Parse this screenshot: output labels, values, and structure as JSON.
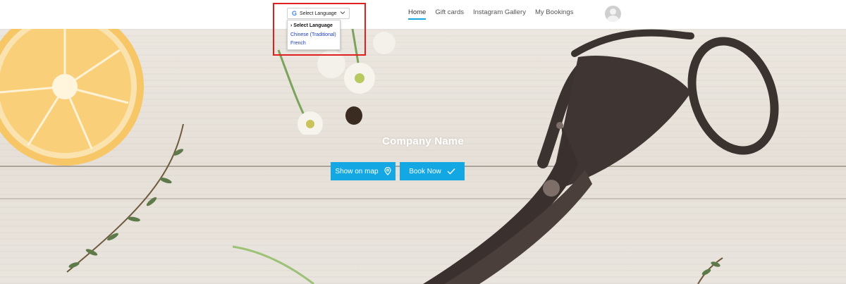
{
  "header": {
    "language_widget": {
      "selected": "Select Language",
      "google_icon": "G",
      "options": [
        "› Select Language",
        "Chinese (Traditional)",
        "French"
      ]
    },
    "nav": {
      "items": [
        "Home",
        "Gift cards",
        "Instagram Gallery",
        "My Bookings"
      ],
      "active_index": 0
    },
    "avatar_icon": "user-avatar-icon"
  },
  "hero": {
    "company_name": "Company Name",
    "buttons": {
      "show_on_map": "Show on map",
      "book_now": "Book Now"
    }
  },
  "colors": {
    "accent": "#13a8e3",
    "highlight": "#e01f1f",
    "link": "#1a3cc8"
  }
}
